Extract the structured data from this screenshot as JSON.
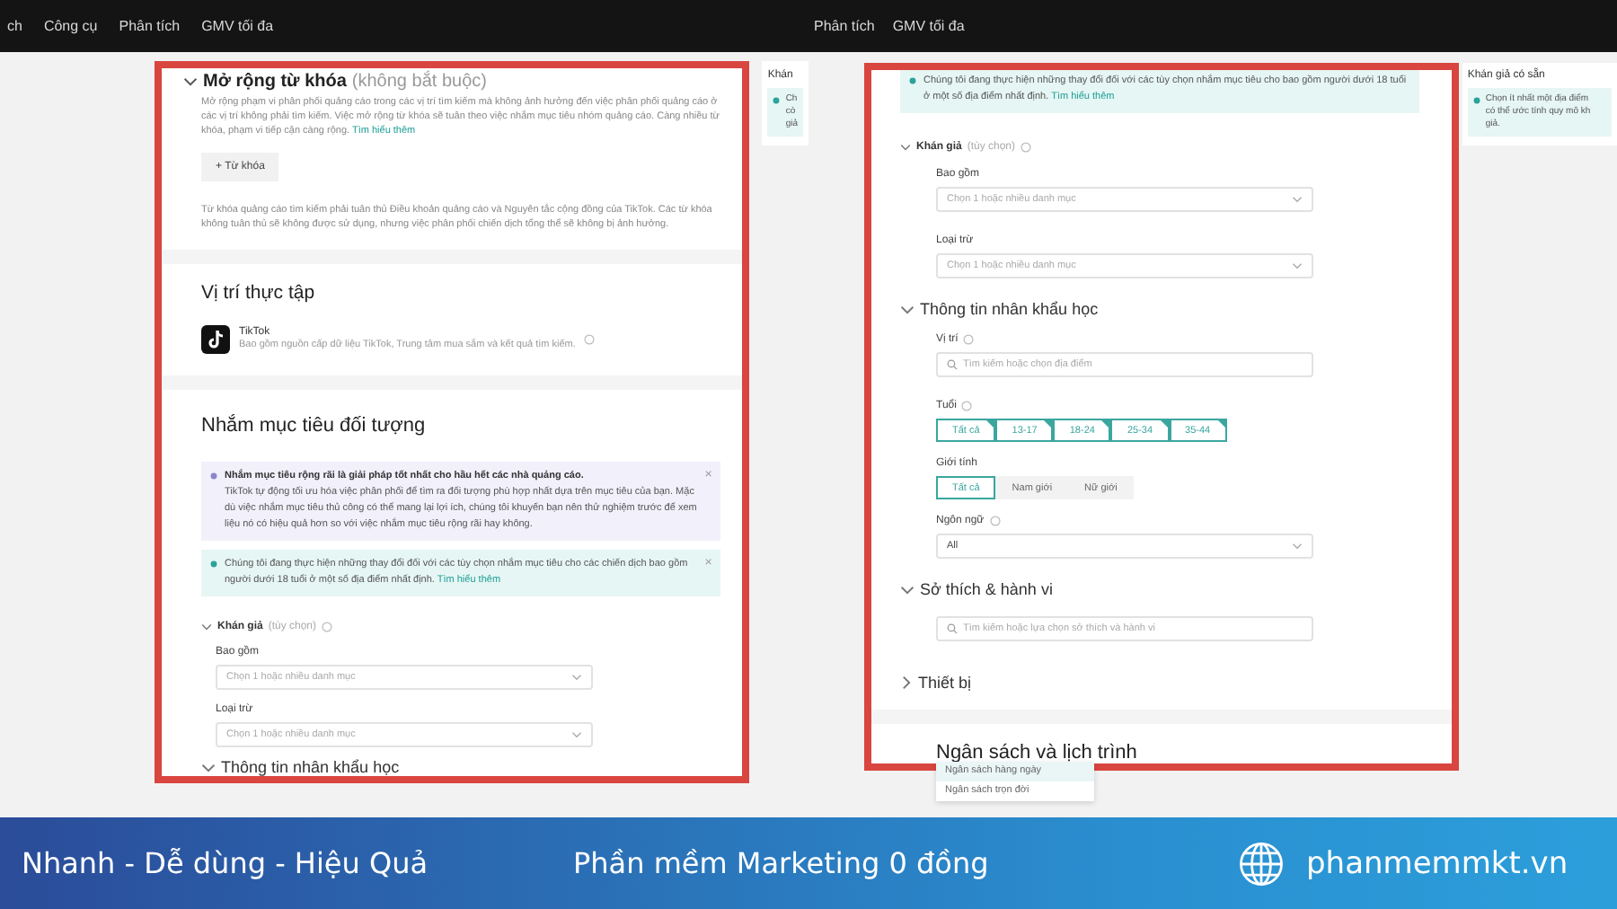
{
  "panels": [
    {
      "nav": [
        "ch",
        "Công cụ",
        "Phân tích",
        "GMV tối đa"
      ],
      "frame": [
        {
          "kind": "keyword_section",
          "title": "Mở rộng từ khóa",
          "optional": "(không bắt buộc)",
          "description": "Mở rộng phạm vi phân phối quảng cáo trong các vị trí tìm kiếm mà không ảnh hưởng đến việc phân phối quảng cáo ở các vị trí không phải tìm kiếm. Việc mở rộng từ khóa sẽ tuân theo việc nhắm mục tiêu nhóm quảng cáo. Càng nhiều từ khóa, phạm vi tiếp cận càng rộng.",
          "link": "Tìm hiểu thêm",
          "button": "+ Từ khóa",
          "note": "Từ khóa quảng cáo tìm kiếm phải tuân thủ Điều khoản quảng cáo và Nguyên tắc cộng đồng của TikTok. Các từ khóa không tuân thủ sẽ không được sử dụng, nhưng việc phân phối chiến dịch tổng thể sẽ không bị ảnh hưởng."
        },
        {
          "kind": "divider"
        },
        {
          "kind": "placement",
          "heading": "Vị trí thực tập",
          "app": "TikTok",
          "description": "Bao gồm nguồn cấp dữ liệu TikTok, Trung tâm mua sắm và kết quả tìm kiếm."
        },
        {
          "kind": "divider"
        },
        {
          "kind": "heading",
          "text": "Nhắm mục tiêu đối tượng"
        },
        {
          "kind": "tip",
          "title": "Nhắm mục tiêu rộng rãi là giải pháp tốt nhất cho hầu hết các nhà quảng cáo.",
          "text": "TikTok tự động tối ưu hóa việc phân phối để tìm ra đối tượng phù hợp nhất dựa trên mục tiêu của bạn. Mặc dù việc nhắm mục tiêu thủ công có thể mang lại lợi ích, chúng tôi khuyến bạn nên thử nghiệm trước để xem liệu nó có hiệu quả hơn so với việc nhắm mục tiêu rộng rãi hay không.",
          "close": "×"
        },
        {
          "kind": "notice",
          "text": "Chúng tôi đang thực hiện những thay đổi đối với các tùy chọn nhắm mục tiêu cho các chiến dịch bao gồm người dưới 18 tuổi ở một số địa điểm nhất định.",
          "link": "Tìm hiểu thêm",
          "close": "×"
        },
        {
          "kind": "subgroup",
          "text": "Khán giả",
          "hint": "(tùy chọn)",
          "expanded": true
        },
        {
          "kind": "label",
          "text": "Bao gồm",
          "info": false
        },
        {
          "kind": "select",
          "placeholder": "Chọn 1 hoặc nhiều danh mục"
        },
        {
          "kind": "label",
          "text": "Loại trừ",
          "info": false
        },
        {
          "kind": "select",
          "placeholder": "Chọn 1 hoặc nhiều danh mục"
        },
        {
          "kind": "group",
          "text": "Thông tin nhân khẩu học",
          "expanded": true
        }
      ],
      "side": {
        "title": "Khán",
        "lines": [
          "Ch",
          "cò",
          "giả"
        ]
      }
    },
    {
      "nav": [
        "Phân tích",
        "GMV tối đa"
      ],
      "frame": [
        {
          "kind": "notice",
          "text": "Chúng tôi đang thực hiện những thay đổi đối với các tùy chọn nhắm mục tiêu cho bao gồm người dưới 18 tuổi ở một số địa điểm nhất định.",
          "link": "Tìm hiểu thêm"
        },
        {
          "kind": "subgroup",
          "text": "Khán giả",
          "hint": "(tùy chọn)",
          "expanded": true
        },
        {
          "kind": "label",
          "text": "Bao gồm",
          "info": false
        },
        {
          "kind": "select",
          "placeholder": "Chọn 1 hoặc nhiều danh mục"
        },
        {
          "kind": "label",
          "text": "Loại trừ",
          "info": false
        },
        {
          "kind": "select",
          "placeholder": "Chọn 1 hoặc nhiều danh mục"
        },
        {
          "kind": "group",
          "text": "Thông tin nhân khẩu học",
          "expanded": true
        },
        {
          "kind": "label",
          "text": "Vị trí",
          "info": true
        },
        {
          "kind": "search",
          "placeholder": "Tìm kiếm hoặc chọn địa điểm"
        },
        {
          "kind": "label",
          "text": "Tuổi",
          "info": true
        },
        {
          "kind": "chips",
          "multi": true,
          "options": [
            {
              "label": "Tất cả",
              "selected": true
            },
            {
              "label": "13-17",
              "selected": true
            },
            {
              "label": "18-24",
              "selected": true
            },
            {
              "label": "25-34",
              "selected": true
            },
            {
              "label": "35-44",
              "selected": true
            }
          ]
        },
        {
          "kind": "label",
          "text": "Giới tính",
          "info": false
        },
        {
          "kind": "chips",
          "multi": false,
          "options": [
            {
              "label": "Tất cả",
              "selected": true
            },
            {
              "label": "Nam giới",
              "selected": false
            },
            {
              "label": "Nữ giới",
              "selected": false
            }
          ]
        },
        {
          "kind": "label",
          "text": "Ngôn ngữ",
          "info": true
        },
        {
          "kind": "select",
          "value": "All"
        },
        {
          "kind": "group",
          "text": "Sở thích & hành vi",
          "expanded": true
        },
        {
          "kind": "search",
          "placeholder": "Tìm kiếm hoặc lựa chọn sở thích và hành vi"
        },
        {
          "kind": "group",
          "text": "Thiết bị",
          "expanded": false
        },
        {
          "kind": "divider"
        },
        {
          "kind": "heading",
          "text": "Ngân sách và lịch trình",
          "menu": [
            {
              "label": "Ngân sách hàng ngày",
              "selected": true
            },
            {
              "label": "Ngân sách trọn đời",
              "selected": false
            }
          ]
        }
      ],
      "side": {
        "title": "Khán giả có sẵn",
        "lines": [
          "Chọn ít nhất một địa điểm",
          "có thể ước tính quy mô kh",
          "giả."
        ]
      }
    }
  ],
  "footer": {
    "slogans": [
      "Nhanh - Dễ dùng - Hiệu Quả",
      "Phần mềm Marketing 0 đồng"
    ],
    "site": "phanmemmkt.vn"
  }
}
